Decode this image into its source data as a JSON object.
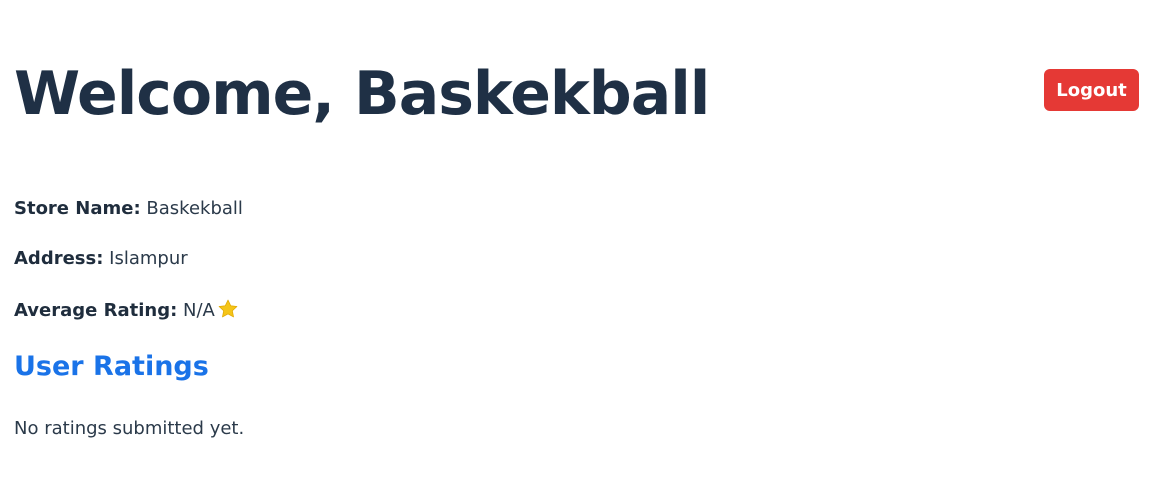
{
  "header": {
    "title": "Welcome, Baskekball",
    "logout_label": "Logout"
  },
  "store": {
    "name_label": "Store Name:",
    "name_value": "Baskekball",
    "address_label": "Address:",
    "address_value": "Islampur",
    "rating_label": "Average Rating:",
    "rating_value": "N/A",
    "rating_icon": "star-icon"
  },
  "ratings_section": {
    "title": "User Ratings",
    "empty_message": "No ratings submitted yet."
  },
  "colors": {
    "logout_button": "#e53935",
    "section_title": "#1a73e8",
    "heading": "#1f3045",
    "star": "#f5c518"
  }
}
